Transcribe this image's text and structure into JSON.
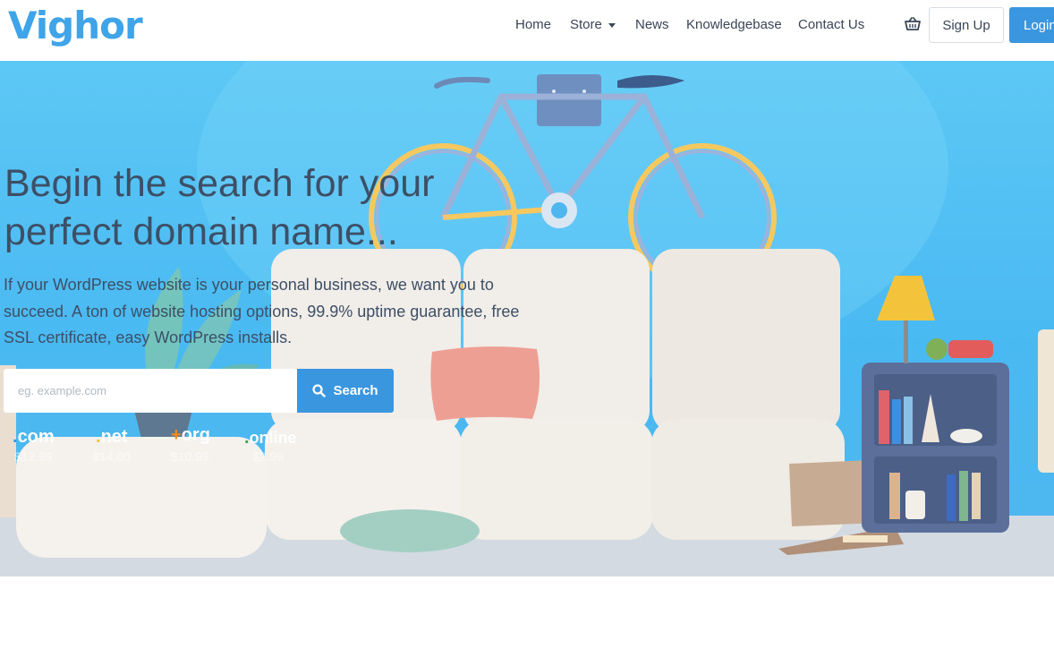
{
  "brand": {
    "logo": "Vighor"
  },
  "nav": {
    "home": "Home",
    "store": "Store",
    "news": "News",
    "knowledgebase": "Knowledgebase",
    "contact": "Contact Us",
    "signup": "Sign Up",
    "login": "Login"
  },
  "hero": {
    "title_line1": "Begin the search for your",
    "title_line2": "perfect domain name...",
    "subtitle": "If your WordPress website is your personal business, we want you to succeed. A ton of website hosting options, 99.9% uptime guarantee, free SSL certificate, easy WordPress installs.",
    "search_placeholder": "eg. example.com",
    "search_button": "Search"
  },
  "tlds": [
    {
      "name": "com",
      "price": "$12.99",
      "dot_color": "#2e9bff"
    },
    {
      "name": "net",
      "price": "$14.00",
      "dot_color": "#f3c43b"
    },
    {
      "name": "org",
      "price": "$10.99",
      "dot_color": "#f28a1f"
    },
    {
      "name": "online",
      "price": "$2.99",
      "dot_color": "#3aa845"
    }
  ],
  "colors": {
    "brand_blue": "#3fa4e8",
    "button_blue": "#3a96df",
    "text_dark": "#3d4f66",
    "hero_bg": "#4fb6ee"
  }
}
